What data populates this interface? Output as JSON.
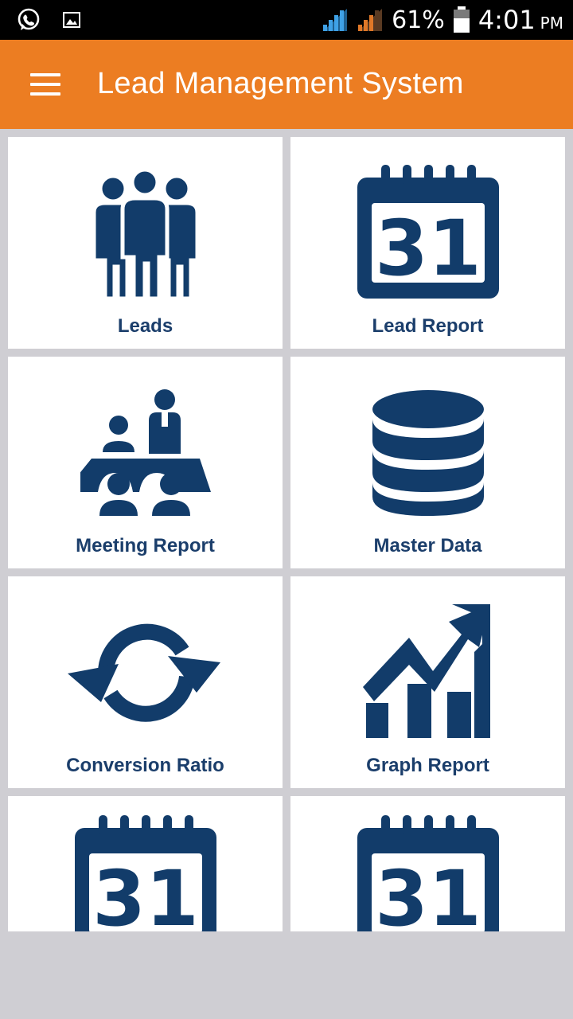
{
  "status_bar": {
    "battery": "61%",
    "time": "4:01",
    "ampm": "PM",
    "icons": [
      "whatsapp-icon",
      "image-icon",
      "signal-icon-1",
      "signal-icon-2",
      "battery-icon"
    ]
  },
  "app_bar": {
    "title": "Lead Management System",
    "menu_icon": "hamburger-menu-icon",
    "background": "#ec7d22"
  },
  "colors": {
    "icon": "#123c6a",
    "label": "#1b3e6b",
    "page_bg": "#cfced3",
    "tile_bg": "#ffffff"
  },
  "tiles": [
    {
      "label": "Leads",
      "icon": "people-group-icon"
    },
    {
      "label": "Lead Report",
      "icon": "calendar-31-icon"
    },
    {
      "label": "Meeting Report",
      "icon": "meeting-icon"
    },
    {
      "label": "Master Data",
      "icon": "database-icon"
    },
    {
      "label": "Conversion Ratio",
      "icon": "refresh-arrows-icon"
    },
    {
      "label": "Graph Report",
      "icon": "growth-chart-icon"
    },
    {
      "label": "",
      "icon": "calendar-31-icon"
    },
    {
      "label": "",
      "icon": "calendar-31-icon"
    }
  ]
}
